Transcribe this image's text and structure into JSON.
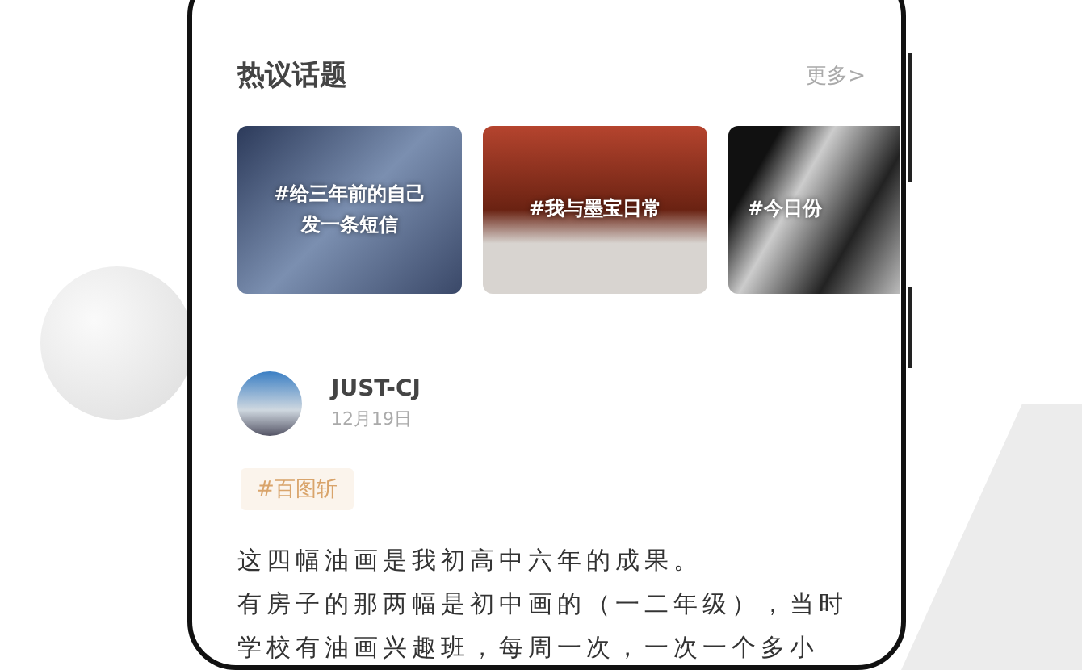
{
  "section": {
    "title": "热议话题",
    "more_link": "更多>"
  },
  "topics": [
    {
      "label": "#给三年前的自己发一条短信"
    },
    {
      "label": "#我与墨宝日常"
    },
    {
      "label": "#今日份"
    }
  ],
  "post": {
    "author": "JUST-CJ",
    "date": "12月19日",
    "tag": "#百图斩",
    "lines": [
      "这四幅油画是我初高中六年的成果。",
      "有房子的那两幅是初中画的（一二年级），当时",
      "学校有油画兴趣班，每周一次，一次一个多小"
    ]
  }
}
